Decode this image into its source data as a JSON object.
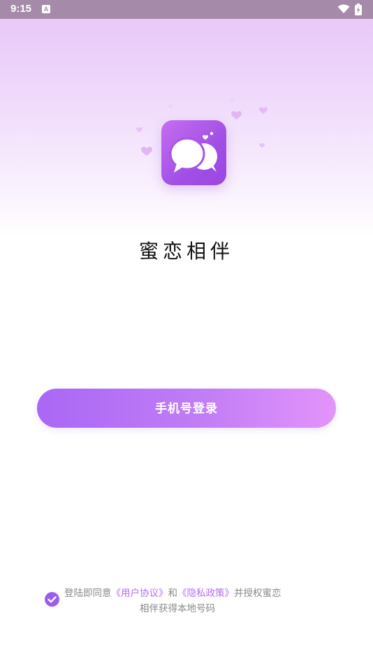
{
  "status_bar": {
    "time": "9:15",
    "left_icon": "a-notification-icon",
    "right_icons": [
      "wifi-icon",
      "battery-charging-icon"
    ]
  },
  "app": {
    "icon": "chat-bubbles-heart-icon",
    "name": "蜜恋相伴"
  },
  "login": {
    "phone_button_label": "手机号登录"
  },
  "agreement": {
    "checked": true,
    "prefix": "登陆即同意",
    "user_agreement_link": "《用户协议》",
    "and": "和",
    "privacy_policy_link": "《隐私政策》",
    "suffix_line1": "并授权蜜恋",
    "line2": "相伴获得本地号码"
  },
  "colors": {
    "accent": "#a967f5",
    "accent_end": "#e394fb",
    "link": "#b36ff0",
    "status_bar": "#a58ba9"
  }
}
